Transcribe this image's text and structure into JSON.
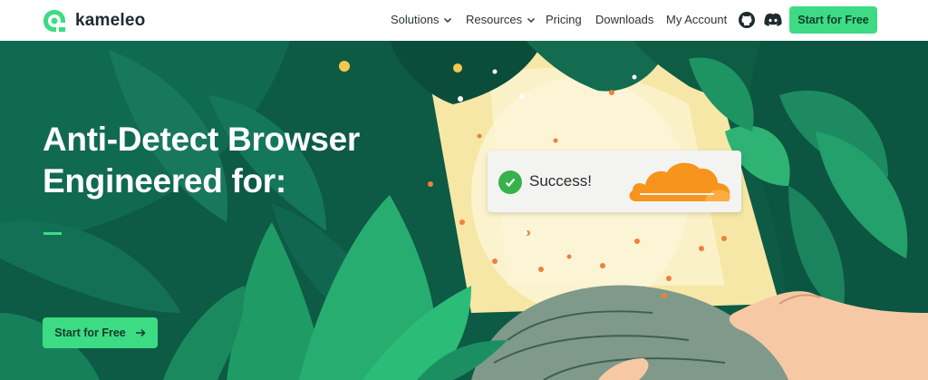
{
  "brand": {
    "name": "kameleo",
    "accent": "#3ddc84",
    "dark_green": "#0d5a45"
  },
  "nav": {
    "items": [
      {
        "label": "Solutions",
        "dropdown": true
      },
      {
        "label": "Resources",
        "dropdown": true
      },
      {
        "label": "Pricing",
        "dropdown": false
      },
      {
        "label": "Downloads",
        "dropdown": false
      },
      {
        "label": "My Account",
        "dropdown": false
      }
    ],
    "icons": [
      "github-icon",
      "discord-icon"
    ],
    "cta_label": "Start for Free"
  },
  "hero": {
    "headline_line1": "Anti-Detect Browser",
    "headline_line2": "Engineered for:",
    "cta_label": "Start for Free",
    "success_label": "Success!",
    "badge_icon": "cloudflare-cloud-icon",
    "check_icon": "check-circle-icon"
  }
}
